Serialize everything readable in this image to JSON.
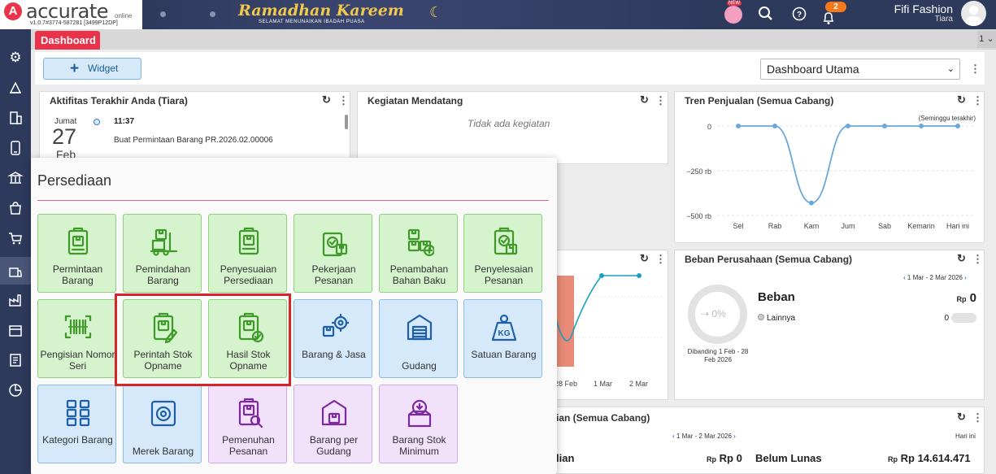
{
  "header": {
    "logo_text": "accurate",
    "logo_online": "online",
    "version": "v1.0.7#3774-587281 [3499P12DP]",
    "banner_title": "Ramadhan Kareem",
    "banner_subtitle": "SELAMAT MENUNAIKAN IBADAH PUASA",
    "new_badge": "NEW",
    "notification_count": "2",
    "company": "Fifi Fashion",
    "user": "Tiara"
  },
  "tabs": {
    "active": "Dashboard",
    "count": "1 ⌄"
  },
  "toolbar": {
    "widget_label": "Widget",
    "dashboard_select": "Dashboard Utama"
  },
  "activity": {
    "title": "Aktifitas Terakhir Anda (Tiara)",
    "day": "Jumat",
    "date": "27",
    "month": "Feb",
    "time": "11:37",
    "description": "Buat Permintaan Barang PR.2026.02.00006"
  },
  "upcoming": {
    "title": "Kegiatan Mendatang",
    "empty": "Tidak ada kegiatan"
  },
  "trend": {
    "title": "Tren Penjualan (Semua Cabang)",
    "note": "(Seminggu terakhir)"
  },
  "chart_data": {
    "type": "line",
    "title": "Tren Penjualan (Semua Cabang)",
    "subtitle": "(Seminggu terakhir)",
    "categories": [
      "Sel",
      "Rab",
      "Kam",
      "Jum",
      "Sab",
      "Kemarin",
      "Hari ini"
    ],
    "values": [
      0,
      0,
      -430,
      0,
      0,
      0,
      0
    ],
    "y_tick_labels": [
      "0",
      "−250 rb",
      "−500 rb"
    ],
    "ylim": [
      -500,
      0
    ],
    "unit": "rb",
    "grid": "horizontal dashed"
  },
  "middle_chart": {
    "x_labels": [
      "28 Feb",
      "1 Mar",
      "2 Mar"
    ]
  },
  "beban": {
    "title": "Beban Perusahaan (Semua Cabang)",
    "period": "1 Mar - 2 Mar 2026",
    "label": "Beban",
    "currency": "Rp",
    "value": "0",
    "item": "Lainnya",
    "item_value": "0",
    "donut_pct": "0%",
    "donut_fraction": 0,
    "compare": "Dibanding 1 Feb - 28 Feb 2026"
  },
  "bottom": {
    "title_fragment": "ian (Semua Cabang)",
    "period": "1 Mar - 2 Mar 2026",
    "hari": "Hari ini",
    "left_label": "lian",
    "currency": "Rp",
    "left_value": "Rp 0",
    "mid_label": "Belum Lunas",
    "right_value": "Rp 14.614.471"
  },
  "popup": {
    "title": "Persediaan",
    "tiles": [
      {
        "label": "Permintaan Barang",
        "color": "green",
        "icon": "clipboard-box-icon"
      },
      {
        "label": "Pemindahan Barang",
        "color": "green",
        "icon": "forklift-icon"
      },
      {
        "label": "Penyesuaian Persediaan",
        "color": "green",
        "icon": "adjust-box-icon"
      },
      {
        "label": "Pekerjaan Pesanan",
        "color": "green",
        "icon": "job-order-icon"
      },
      {
        "label": "Penambahan Bahan Baku",
        "color": "green",
        "icon": "add-material-icon"
      },
      {
        "label": "Penyelesaian Pesanan",
        "color": "green",
        "icon": "order-complete-icon"
      },
      {
        "label": "Pengisian Nomor Seri",
        "color": "green",
        "icon": "barcode-icon"
      },
      {
        "label": "Perintah Stok Opname",
        "color": "green",
        "icon": "stock-opname-order-icon"
      },
      {
        "label": "Hasil Stok Opname",
        "color": "green",
        "icon": "stock-opname-result-icon"
      },
      {
        "label": "Barang & Jasa",
        "color": "blue",
        "icon": "item-service-icon"
      },
      {
        "label": "Gudang",
        "color": "blue",
        "icon": "warehouse-icon"
      },
      {
        "label": "Satuan Barang",
        "color": "blue",
        "icon": "weight-kg-icon"
      },
      {
        "label": "Kategori Barang",
        "color": "blue",
        "icon": "category-icon"
      },
      {
        "label": "Merek Barang",
        "color": "blue",
        "icon": "brand-icon"
      },
      {
        "label": "Pemenuhan Pesanan",
        "color": "purple",
        "icon": "order-fulfillment-icon"
      },
      {
        "label": "Barang per Gudang",
        "color": "purple",
        "icon": "warehouse-stock-icon"
      },
      {
        "label": "Barang Stok Minimum",
        "color": "purple",
        "icon": "minimum-stock-icon"
      }
    ]
  },
  "colors": {
    "brand_red": "#e8334a",
    "nav_dark": "#2e3a5c",
    "green_tile": "#d5f3cc",
    "blue_tile": "#d5e9fb",
    "purple_tile": "#f1e1fb",
    "highlight": "#d7242b",
    "line": "#6aa8dc"
  }
}
